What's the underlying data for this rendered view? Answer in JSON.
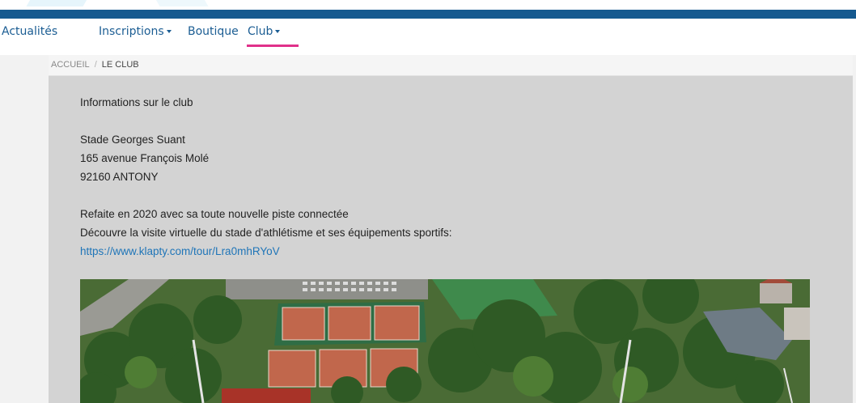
{
  "nav": {
    "items": [
      {
        "label": "Actualités"
      },
      {
        "label": "Inscriptions"
      },
      {
        "label": "Boutique"
      },
      {
        "label": "Club"
      }
    ]
  },
  "breadcrumb": {
    "home": "ACCUEIL",
    "separator": "/",
    "current": "LE CLUB"
  },
  "content": {
    "heading": "Informations sur le club",
    "address": [
      "Stade Georges Suant",
      "165 avenue François Molé",
      "92160 ANTONY"
    ],
    "description": [
      "Refaite en 2020 avec sa toute nouvelle piste connectée",
      "Découvre la visite virtuelle du stade d'athlétisme et ses équipements sportifs:"
    ],
    "link": "https://www.klapty.com/tour/Lra0mhRYoV"
  },
  "colors": {
    "topbar": "#15598f",
    "nav_text": "#1b5d93",
    "active_underline": "#e0318a",
    "content_bg": "#d3d3d3",
    "link": "#1f75b8"
  }
}
